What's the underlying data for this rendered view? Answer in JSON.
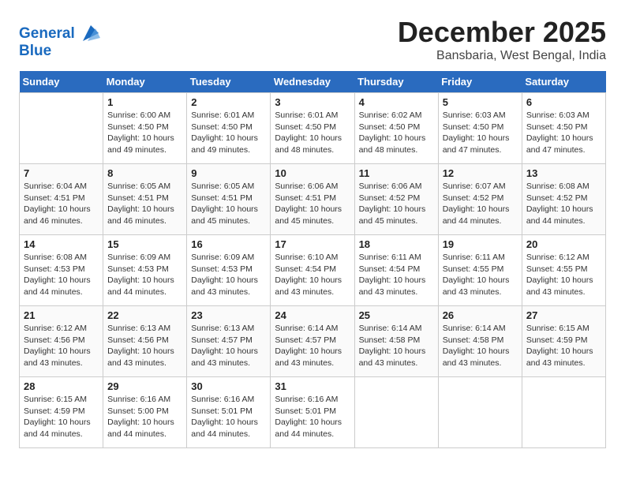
{
  "header": {
    "logo_line1": "General",
    "logo_line2": "Blue",
    "month": "December 2025",
    "location": "Bansbaria, West Bengal, India"
  },
  "days_of_week": [
    "Sunday",
    "Monday",
    "Tuesday",
    "Wednesday",
    "Thursday",
    "Friday",
    "Saturday"
  ],
  "weeks": [
    [
      {
        "day": "",
        "info": ""
      },
      {
        "day": "1",
        "info": "Sunrise: 6:00 AM\nSunset: 4:50 PM\nDaylight: 10 hours\nand 49 minutes."
      },
      {
        "day": "2",
        "info": "Sunrise: 6:01 AM\nSunset: 4:50 PM\nDaylight: 10 hours\nand 49 minutes."
      },
      {
        "day": "3",
        "info": "Sunrise: 6:01 AM\nSunset: 4:50 PM\nDaylight: 10 hours\nand 48 minutes."
      },
      {
        "day": "4",
        "info": "Sunrise: 6:02 AM\nSunset: 4:50 PM\nDaylight: 10 hours\nand 48 minutes."
      },
      {
        "day": "5",
        "info": "Sunrise: 6:03 AM\nSunset: 4:50 PM\nDaylight: 10 hours\nand 47 minutes."
      },
      {
        "day": "6",
        "info": "Sunrise: 6:03 AM\nSunset: 4:50 PM\nDaylight: 10 hours\nand 47 minutes."
      }
    ],
    [
      {
        "day": "7",
        "info": "Sunrise: 6:04 AM\nSunset: 4:51 PM\nDaylight: 10 hours\nand 46 minutes."
      },
      {
        "day": "8",
        "info": "Sunrise: 6:05 AM\nSunset: 4:51 PM\nDaylight: 10 hours\nand 46 minutes."
      },
      {
        "day": "9",
        "info": "Sunrise: 6:05 AM\nSunset: 4:51 PM\nDaylight: 10 hours\nand 45 minutes."
      },
      {
        "day": "10",
        "info": "Sunrise: 6:06 AM\nSunset: 4:51 PM\nDaylight: 10 hours\nand 45 minutes."
      },
      {
        "day": "11",
        "info": "Sunrise: 6:06 AM\nSunset: 4:52 PM\nDaylight: 10 hours\nand 45 minutes."
      },
      {
        "day": "12",
        "info": "Sunrise: 6:07 AM\nSunset: 4:52 PM\nDaylight: 10 hours\nand 44 minutes."
      },
      {
        "day": "13",
        "info": "Sunrise: 6:08 AM\nSunset: 4:52 PM\nDaylight: 10 hours\nand 44 minutes."
      }
    ],
    [
      {
        "day": "14",
        "info": "Sunrise: 6:08 AM\nSunset: 4:53 PM\nDaylight: 10 hours\nand 44 minutes."
      },
      {
        "day": "15",
        "info": "Sunrise: 6:09 AM\nSunset: 4:53 PM\nDaylight: 10 hours\nand 44 minutes."
      },
      {
        "day": "16",
        "info": "Sunrise: 6:09 AM\nSunset: 4:53 PM\nDaylight: 10 hours\nand 43 minutes."
      },
      {
        "day": "17",
        "info": "Sunrise: 6:10 AM\nSunset: 4:54 PM\nDaylight: 10 hours\nand 43 minutes."
      },
      {
        "day": "18",
        "info": "Sunrise: 6:11 AM\nSunset: 4:54 PM\nDaylight: 10 hours\nand 43 minutes."
      },
      {
        "day": "19",
        "info": "Sunrise: 6:11 AM\nSunset: 4:55 PM\nDaylight: 10 hours\nand 43 minutes."
      },
      {
        "day": "20",
        "info": "Sunrise: 6:12 AM\nSunset: 4:55 PM\nDaylight: 10 hours\nand 43 minutes."
      }
    ],
    [
      {
        "day": "21",
        "info": "Sunrise: 6:12 AM\nSunset: 4:56 PM\nDaylight: 10 hours\nand 43 minutes."
      },
      {
        "day": "22",
        "info": "Sunrise: 6:13 AM\nSunset: 4:56 PM\nDaylight: 10 hours\nand 43 minutes."
      },
      {
        "day": "23",
        "info": "Sunrise: 6:13 AM\nSunset: 4:57 PM\nDaylight: 10 hours\nand 43 minutes."
      },
      {
        "day": "24",
        "info": "Sunrise: 6:14 AM\nSunset: 4:57 PM\nDaylight: 10 hours\nand 43 minutes."
      },
      {
        "day": "25",
        "info": "Sunrise: 6:14 AM\nSunset: 4:58 PM\nDaylight: 10 hours\nand 43 minutes."
      },
      {
        "day": "26",
        "info": "Sunrise: 6:14 AM\nSunset: 4:58 PM\nDaylight: 10 hours\nand 43 minutes."
      },
      {
        "day": "27",
        "info": "Sunrise: 6:15 AM\nSunset: 4:59 PM\nDaylight: 10 hours\nand 43 minutes."
      }
    ],
    [
      {
        "day": "28",
        "info": "Sunrise: 6:15 AM\nSunset: 4:59 PM\nDaylight: 10 hours\nand 44 minutes."
      },
      {
        "day": "29",
        "info": "Sunrise: 6:16 AM\nSunset: 5:00 PM\nDaylight: 10 hours\nand 44 minutes."
      },
      {
        "day": "30",
        "info": "Sunrise: 6:16 AM\nSunset: 5:01 PM\nDaylight: 10 hours\nand 44 minutes."
      },
      {
        "day": "31",
        "info": "Sunrise: 6:16 AM\nSunset: 5:01 PM\nDaylight: 10 hours\nand 44 minutes."
      },
      {
        "day": "",
        "info": ""
      },
      {
        "day": "",
        "info": ""
      },
      {
        "day": "",
        "info": ""
      }
    ]
  ]
}
